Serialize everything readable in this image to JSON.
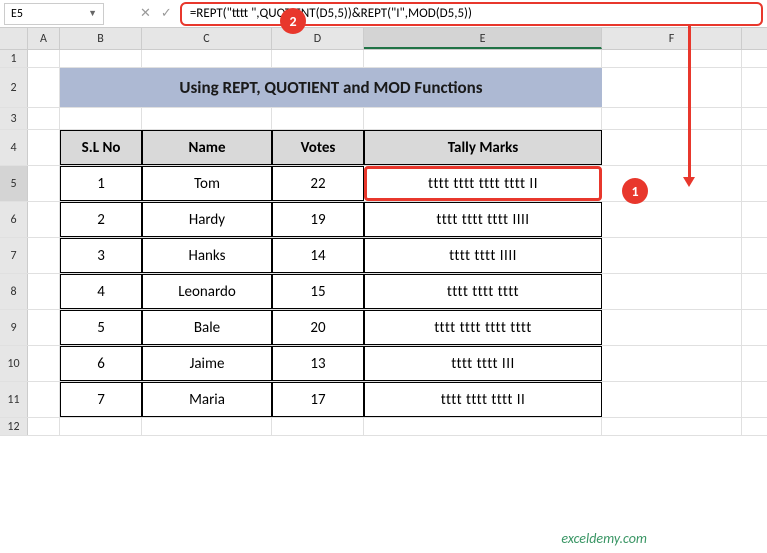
{
  "name_box": "E5",
  "formula": "=REPT(\"tttt \",QUOTIENT(D5,5))&REPT(\"I\",MOD(D5,5))",
  "columns": [
    "A",
    "B",
    "C",
    "D",
    "E",
    "F"
  ],
  "row_labels": [
    "1",
    "2",
    "3",
    "4",
    "5",
    "6",
    "7",
    "8",
    "9",
    "10",
    "11",
    "12"
  ],
  "title": "Using REPT, QUOTIENT and MOD Functions",
  "headers": {
    "sl": "S.L No",
    "name": "Name",
    "votes": "Votes",
    "tally": "Tally Marks"
  },
  "rows": [
    {
      "sl": "1",
      "name": "Tom",
      "votes": "22",
      "tally": "tttt tttt tttt tttt II"
    },
    {
      "sl": "2",
      "name": "Hardy",
      "votes": "19",
      "tally": "tttt tttt tttt IIII"
    },
    {
      "sl": "3",
      "name": "Hanks",
      "votes": "14",
      "tally": "tttt tttt IIII"
    },
    {
      "sl": "4",
      "name": "Leonardo",
      "votes": "15",
      "tally": "tttt tttt tttt "
    },
    {
      "sl": "5",
      "name": "Bale",
      "votes": "20",
      "tally": "tttt tttt tttt tttt "
    },
    {
      "sl": "6",
      "name": "Jaime",
      "votes": "13",
      "tally": "tttt tttt III"
    },
    {
      "sl": "7",
      "name": "Maria",
      "votes": "17",
      "tally": "tttt tttt tttt II"
    }
  ],
  "badges": {
    "b1": "1",
    "b2": "2"
  },
  "watermark": "exceldemy.com",
  "chart_data": {
    "type": "table",
    "title": "Using REPT, QUOTIENT and MOD Functions",
    "columns": [
      "S.L No",
      "Name",
      "Votes",
      "Tally Marks"
    ],
    "data": [
      [
        1,
        "Tom",
        22,
        "tttt tttt tttt tttt II"
      ],
      [
        2,
        "Hardy",
        19,
        "tttt tttt tttt IIII"
      ],
      [
        3,
        "Hanks",
        14,
        "tttt tttt IIII"
      ],
      [
        4,
        "Leonardo",
        15,
        "tttt tttt tttt "
      ],
      [
        5,
        "Bale",
        20,
        "tttt tttt tttt tttt "
      ],
      [
        6,
        "Jaime",
        13,
        "tttt tttt III"
      ],
      [
        7,
        "Maria",
        17,
        "tttt tttt tttt II"
      ]
    ]
  }
}
